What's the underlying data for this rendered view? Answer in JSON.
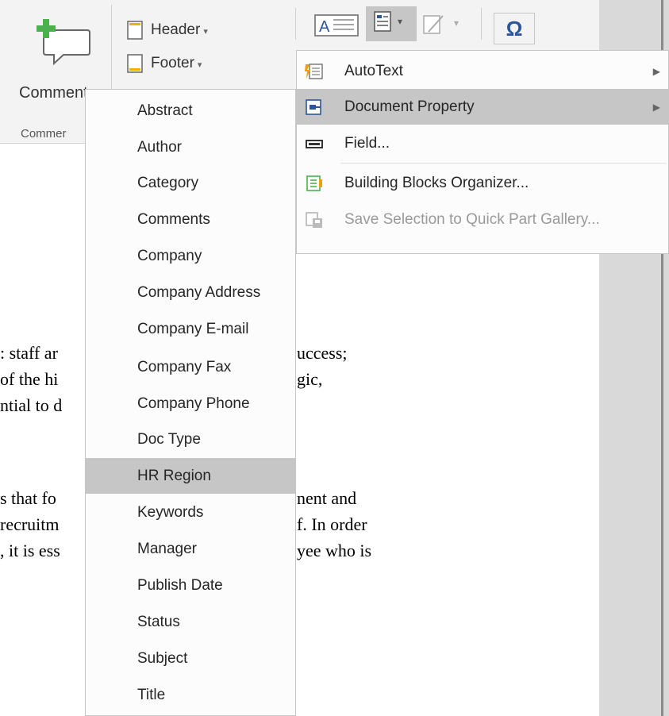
{
  "ribbon": {
    "comment_label": "Comment",
    "group_label": "Commer",
    "header_label": "Header",
    "footer_label": "Footer",
    "text_box_icon": "text-box-icon",
    "quick_parts_icon": "quick-parts-icon",
    "signature_icon": "signature-line-icon",
    "symbol_glyph": "Ω"
  },
  "quick_parts_menu": {
    "items": [
      {
        "label": "AutoText",
        "accel": "A",
        "icon": "autotext-icon",
        "has_submenu": true
      },
      {
        "label": "Document Property",
        "accel": "D",
        "icon": "document-property-icon",
        "has_submenu": true,
        "highlighted": true
      },
      {
        "label": "Field...",
        "accel": "F",
        "icon": "field-icon",
        "has_submenu": false
      },
      {
        "label": "Building Blocks Organizer...",
        "accel": "B",
        "icon": "building-blocks-icon",
        "has_submenu": false
      },
      {
        "label": "Save Selection to Quick Part Gallery...",
        "accel": "S",
        "icon": "save-selection-icon",
        "disabled": true
      }
    ]
  },
  "document_property_menu": {
    "items": [
      "Abstract",
      "Author",
      "Category",
      "Comments",
      "Company",
      "Company Address",
      "Company E-mail",
      "Company Fax",
      "Company Phone",
      "Doc Type",
      "HR Region",
      "Keywords",
      "Manager",
      "Publish Date",
      "Status",
      "Subject",
      "Title"
    ],
    "highlighted": "HR Region"
  },
  "document": {
    "lines_left": [
      ": staff ar",
      "of the hi",
      "ntial to d",
      "s that fo",
      "recruitm",
      ", it is ess"
    ],
    "lines_right": [
      "uccess;",
      "gic,",
      "nent and",
      "f. In order",
      "yee who is"
    ]
  },
  "colors": {
    "ribbon_bg": "#f3f3f3",
    "menu_highlight": "#c6c6c6",
    "comment_plus": "#4caf50",
    "accent_blue": "#2b579a"
  }
}
